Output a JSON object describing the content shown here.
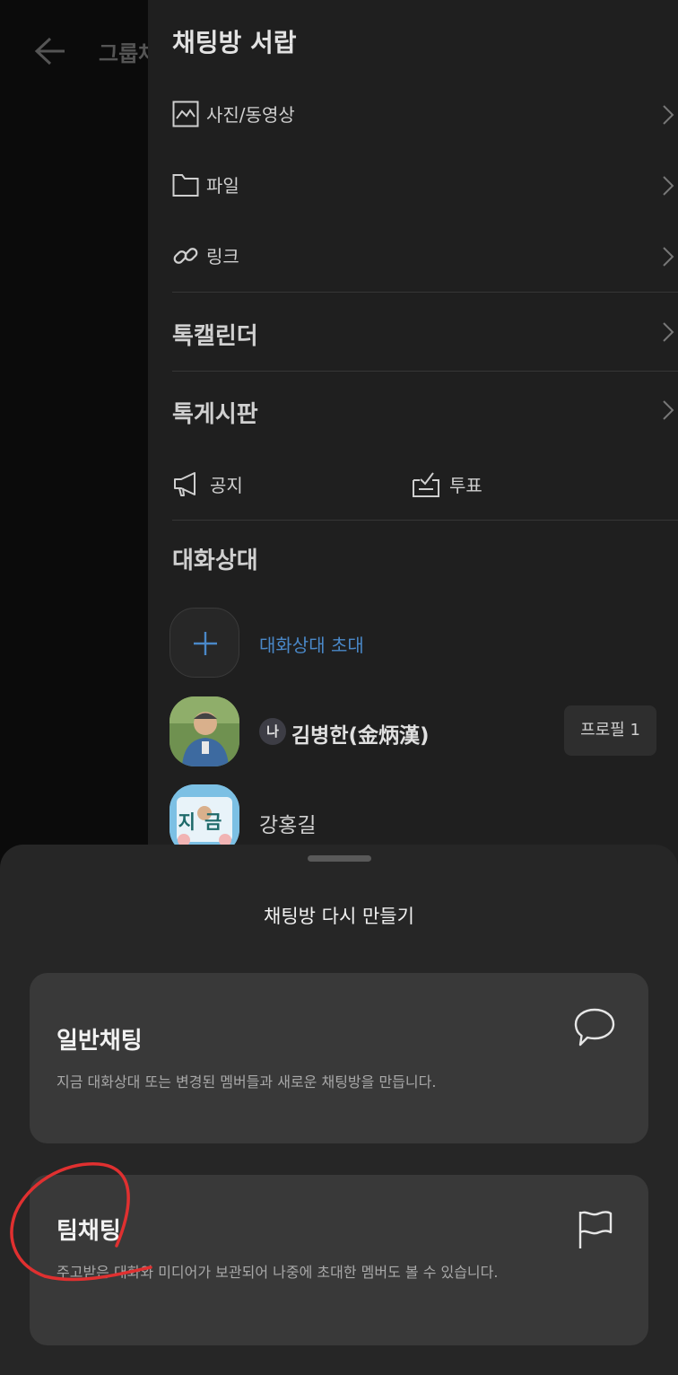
{
  "background": {
    "title": "그룹채"
  },
  "drawer": {
    "title": "채팅방 서랍",
    "items": [
      {
        "label": "사진/동영상",
        "icon": "photo-icon"
      },
      {
        "label": "파일",
        "icon": "folder-icon"
      },
      {
        "label": "링크",
        "icon": "link-icon"
      }
    ],
    "calendar": "톡캘린더",
    "board": "톡게시판",
    "notice": "공지",
    "vote": "투표",
    "members_title": "대화상대",
    "invite_label": "대화상대 초대",
    "members": [
      {
        "badge": "나",
        "name": "김병한(金炳漢)",
        "profile_button": "프로필 1"
      },
      {
        "name": "강홍길",
        "avatar_text": "지금"
      }
    ]
  },
  "sheet": {
    "title": "채팅방 다시 만들기",
    "options": [
      {
        "title": "일반채팅",
        "description": "지금 대화상대 또는 변경된 멤버들과 새로운 채팅방을 만듭니다.",
        "icon": "speech-bubble-icon"
      },
      {
        "title": "팀채팅",
        "description": "주고받은 대화와 미디어가 보관되어 나중에 초대한 멤버도 볼 수 있습니다.",
        "icon": "flag-icon"
      }
    ]
  },
  "colors": {
    "accent": "#4a88c8",
    "annotation": "#e03030"
  }
}
